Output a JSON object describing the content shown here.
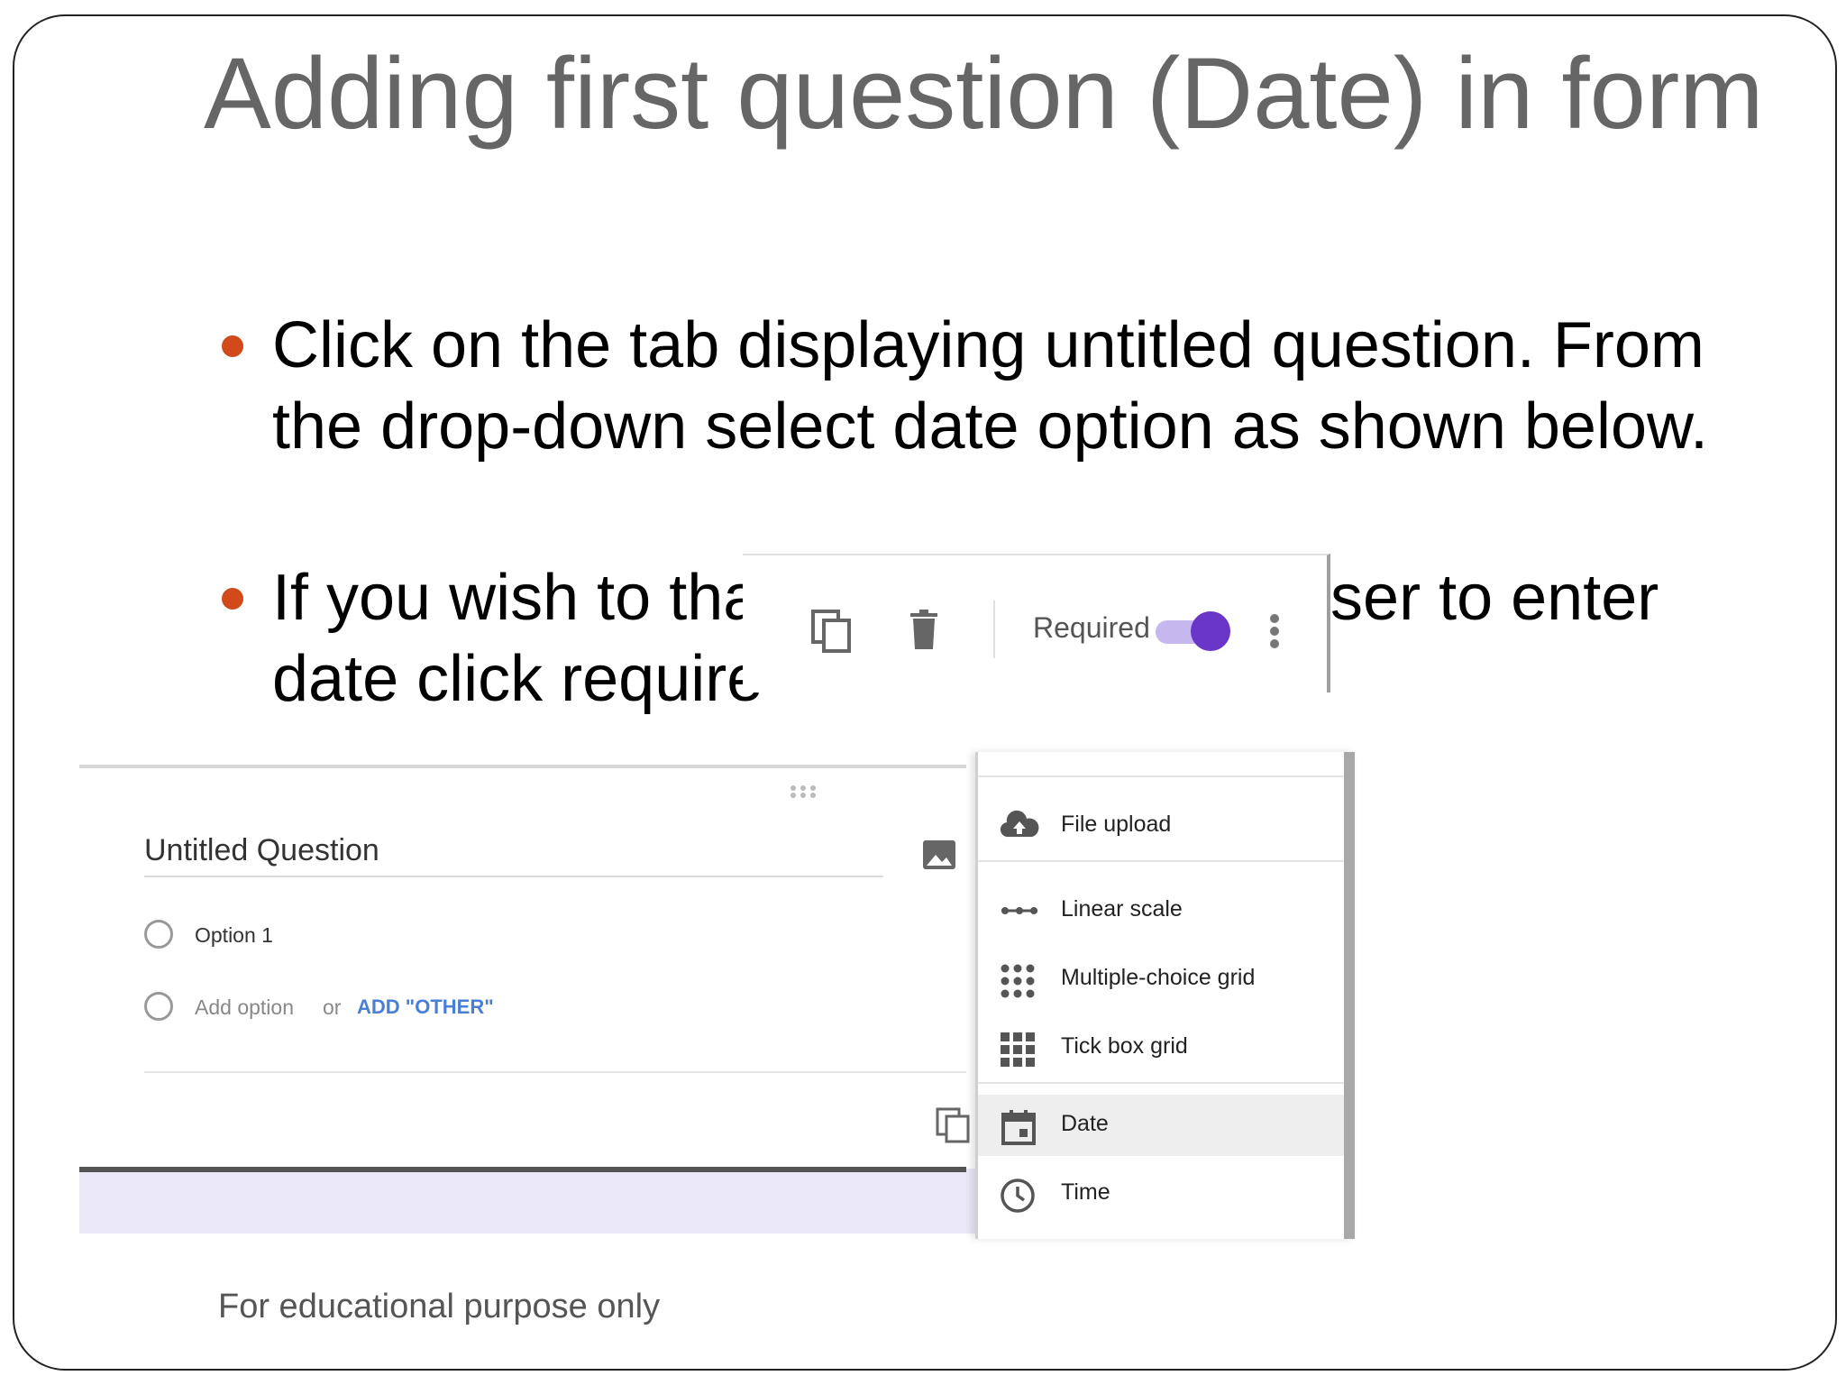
{
  "slide": {
    "title": "Adding first question (Date) in form",
    "bullets": [
      "Click on the tab displaying untitled question. From the drop-down select date option as shown below.",
      "If you wish to tha",
      "user to enter",
      "date click require"
    ],
    "footer": "For educational purpose only",
    "bullet_color": "#d24a1a"
  },
  "toolbar": {
    "required_label": "Required",
    "required_on": true,
    "accent": "#6a35c9",
    "icons": [
      "copy-icon",
      "trash-icon",
      "more-vert-icon"
    ]
  },
  "form": {
    "question_title": "Untitled Question",
    "option1": "Option 1",
    "add_option": "Add option",
    "or_text": "or",
    "add_other": "ADD \"OTHER\""
  },
  "menu": {
    "items": [
      {
        "label": "File upload",
        "icon": "cloud-upload-icon"
      },
      {
        "label": "Linear scale",
        "icon": "linear-scale-icon"
      },
      {
        "label": "Multiple-choice grid",
        "icon": "dot-grid-icon"
      },
      {
        "label": "Tick box grid",
        "icon": "square-grid-icon"
      },
      {
        "label": "Date",
        "icon": "calendar-icon",
        "selected": true
      },
      {
        "label": "Time",
        "icon": "clock-icon"
      }
    ]
  }
}
